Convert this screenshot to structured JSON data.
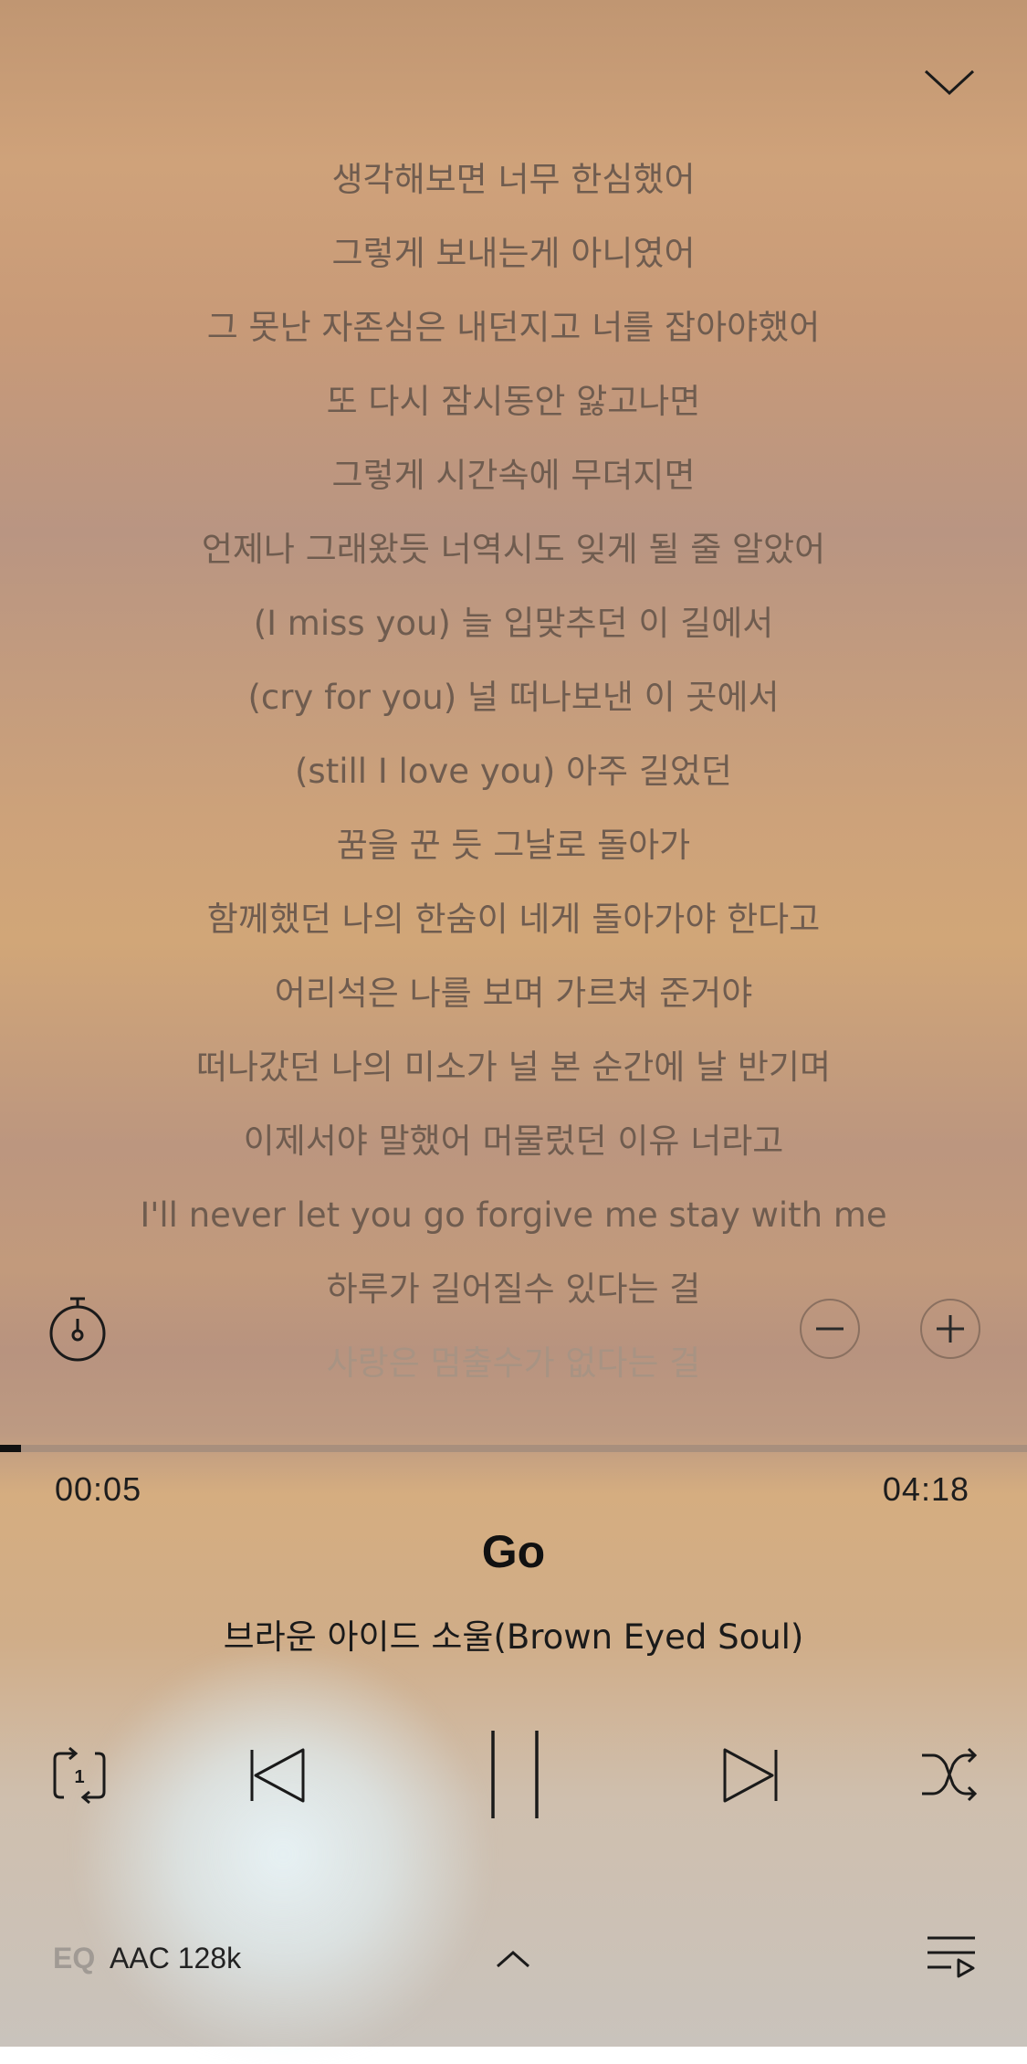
{
  "lyrics": [
    "생각해보면 너무 한심했어",
    "그렇게 보내는게 아니였어",
    "그 못난 자존심은 내던지고 너를 잡아야했어",
    "또 다시 잠시동안 앓고나면",
    "그렇게 시간속에 무뎌지면",
    "언제나 그래왔듯 너역시도 잊게 될 줄 알았어",
    "(I miss you) 늘 입맞추던 이 길에서",
    "(cry for you) 널 떠나보낸 이 곳에서",
    "(still I love you) 아주 길었던",
    "꿈을 꾼 듯 그날로 돌아가",
    "함께했던 나의 한숨이 네게 돌아가야 한다고",
    "어리석은 나를 보며 가르쳐 준거야",
    "떠나갔던 나의 미소가 널 본 순간에 날 반기며",
    "이제서야 말했어 머물렀던 이유 너라고",
    "I'll never let you go forgive me stay with me",
    "하루가 길어질수 있다는 걸",
    "사랑은 멈출수가 없다는 걸"
  ],
  "player": {
    "elapsed": "00:05",
    "duration": "04:18",
    "progress_fraction": 0.02,
    "title": "Go",
    "artist": "브라운 아이드 소울(Brown Eyed Soul)"
  },
  "footer": {
    "eq_label": "EQ",
    "quality": "AAC 128k"
  },
  "icons": {
    "collapse": "chevron-down-icon",
    "timer": "timer-icon",
    "font_smaller": "minus-icon",
    "font_larger": "plus-icon",
    "repeat": "repeat-one-icon",
    "previous": "previous-track-icon",
    "pause": "pause-icon",
    "next": "next-track-icon",
    "shuffle": "shuffle-icon",
    "expand": "chevron-up-icon",
    "playlist": "playlist-icon"
  }
}
